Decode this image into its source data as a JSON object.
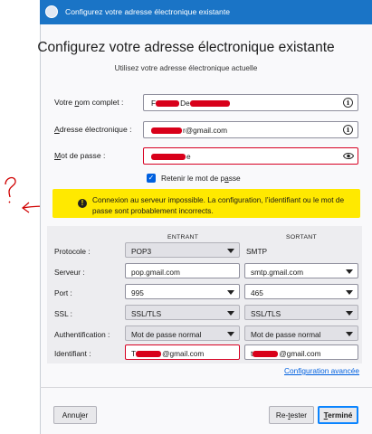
{
  "window": {
    "title": "Configurez votre adresse électronique existante"
  },
  "header": {
    "heading": "Configurez votre adresse électronique existante",
    "subheading": "Utilisez votre adresse électronique actuelle"
  },
  "form": {
    "name": {
      "label_pre": "Votre ",
      "label_u": "n",
      "label_post": "om complet :",
      "value_start": "F",
      "value_end": "De"
    },
    "email": {
      "label_pre": "",
      "label_u": "A",
      "label_post": "dresse électronique :",
      "value_suffix": "r@gmail.com"
    },
    "password": {
      "label_pre": "",
      "label_u": "M",
      "label_post": "ot de passe :",
      "value_suffix": "e"
    },
    "remember": {
      "label_pre": "Retenir le mot de p",
      "label_u": "a",
      "label_post": "sse",
      "checked": true,
      "check_glyph": "✓"
    }
  },
  "warning": {
    "icon": "warning-icon",
    "glyph": "!",
    "text": "Connexion au serveur impossible. La configuration, l’identifiant ou le mot de passe sont probablement incorrects."
  },
  "config": {
    "incoming_header": "ENTRANT",
    "outgoing_header": "SORTANT",
    "protocol": {
      "label": "Protocole :",
      "incoming": "POP3",
      "outgoing": "SMTP"
    },
    "server": {
      "label": "Serveur :",
      "incoming": "pop.gmail.com",
      "outgoing": "smtp.gmail.com"
    },
    "port": {
      "label": "Port :",
      "incoming": "995",
      "outgoing": "465"
    },
    "ssl": {
      "label": "SSL :",
      "incoming": "SSL/TLS",
      "outgoing": "SSL/TLS"
    },
    "auth": {
      "label": "Authentification :",
      "incoming": "Mot de passe normal",
      "outgoing": "Mot de passe normal"
    },
    "username": {
      "label": "Identifiant :",
      "incoming_start": "T",
      "incoming_suffix": "@gmail.com",
      "outgoing_start": "t",
      "outgoing_suffix": "@gmail.com"
    },
    "advanced_link": "Configuration avancée"
  },
  "buttons": {
    "cancel": {
      "pre": "Annu",
      "u": "l",
      "post": "er"
    },
    "retest": {
      "pre": "Re-",
      "u": "t",
      "post": "ester"
    },
    "done": {
      "pre": "",
      "u": "T",
      "post": "erminé"
    }
  },
  "colors": {
    "titlebar": "#1a74c6",
    "warning_bg": "#ffe900",
    "redaction": "#d8001a",
    "link": "#0060df",
    "error_border": "#d70022"
  }
}
